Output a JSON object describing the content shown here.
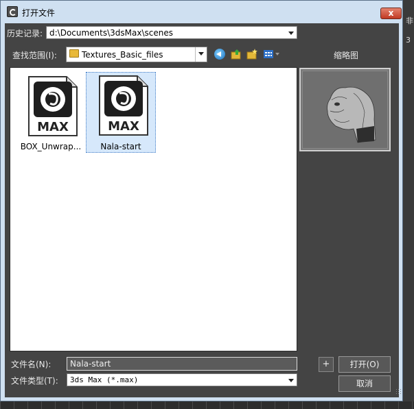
{
  "window": {
    "title": "打开文件",
    "close_label": "x"
  },
  "history": {
    "label": "历史记录:",
    "value": "d:\\Documents\\3dsMax\\scenes"
  },
  "lookin": {
    "label": "查找范围(I):",
    "value": "Textures_Basic_files"
  },
  "toolbar": {
    "icons": [
      "back-icon",
      "up-folder-icon",
      "new-folder-icon",
      "views-menu-icon"
    ]
  },
  "files": [
    {
      "name": "BOX_Unwrap...",
      "icon_text": "MAX",
      "selected": false
    },
    {
      "name": "Nala-start",
      "icon_text": "MAX",
      "selected": true
    }
  ],
  "thumbnail": {
    "title": "缩略图"
  },
  "filename": {
    "label": "文件名(N):",
    "value": "Nala-start"
  },
  "filetype": {
    "label": "文件类型(T):",
    "value": "3ds Max (*.max)"
  },
  "buttons": {
    "open": "打开(O)",
    "cancel": "取消",
    "plus": "+"
  },
  "background": {
    "text_top": "非",
    "text_mid": "3"
  }
}
